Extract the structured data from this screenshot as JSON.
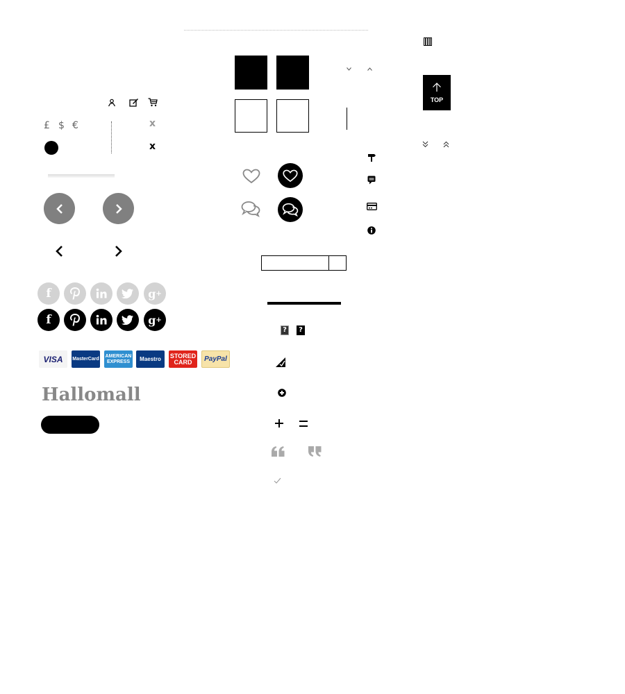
{
  "brand": {
    "logo_text": "Hallomall"
  },
  "currency": {
    "symbols": [
      "£",
      "$",
      "€"
    ]
  },
  "close": {
    "glyph_1": "x",
    "glyph_2": "x"
  },
  "scroll_top": {
    "label": "TOP"
  },
  "payment_cards": [
    {
      "label": "VISA",
      "bg": "#f4f4f4",
      "fg": "#1a1f71"
    },
    {
      "label": "MasterCard",
      "bg": "#0a3a82",
      "fg": "#ffffff"
    },
    {
      "label": "AMERICAN EXPRESS",
      "bg": "#2f8fd0",
      "fg": "#ffffff"
    },
    {
      "label": "Maestro",
      "bg": "#0a3a82",
      "fg": "#ffffff"
    },
    {
      "label": "STORED CARD",
      "bg": "#e0241b",
      "fg": "#ffffff"
    },
    {
      "label": "PayPal",
      "bg": "#f7e3a9",
      "fg": "#1c3f94"
    }
  ],
  "help_glyphs": [
    "?",
    "?"
  ],
  "colors": {
    "black": "#000000",
    "grey": "#888888",
    "light_grey": "#d3d3d3"
  }
}
